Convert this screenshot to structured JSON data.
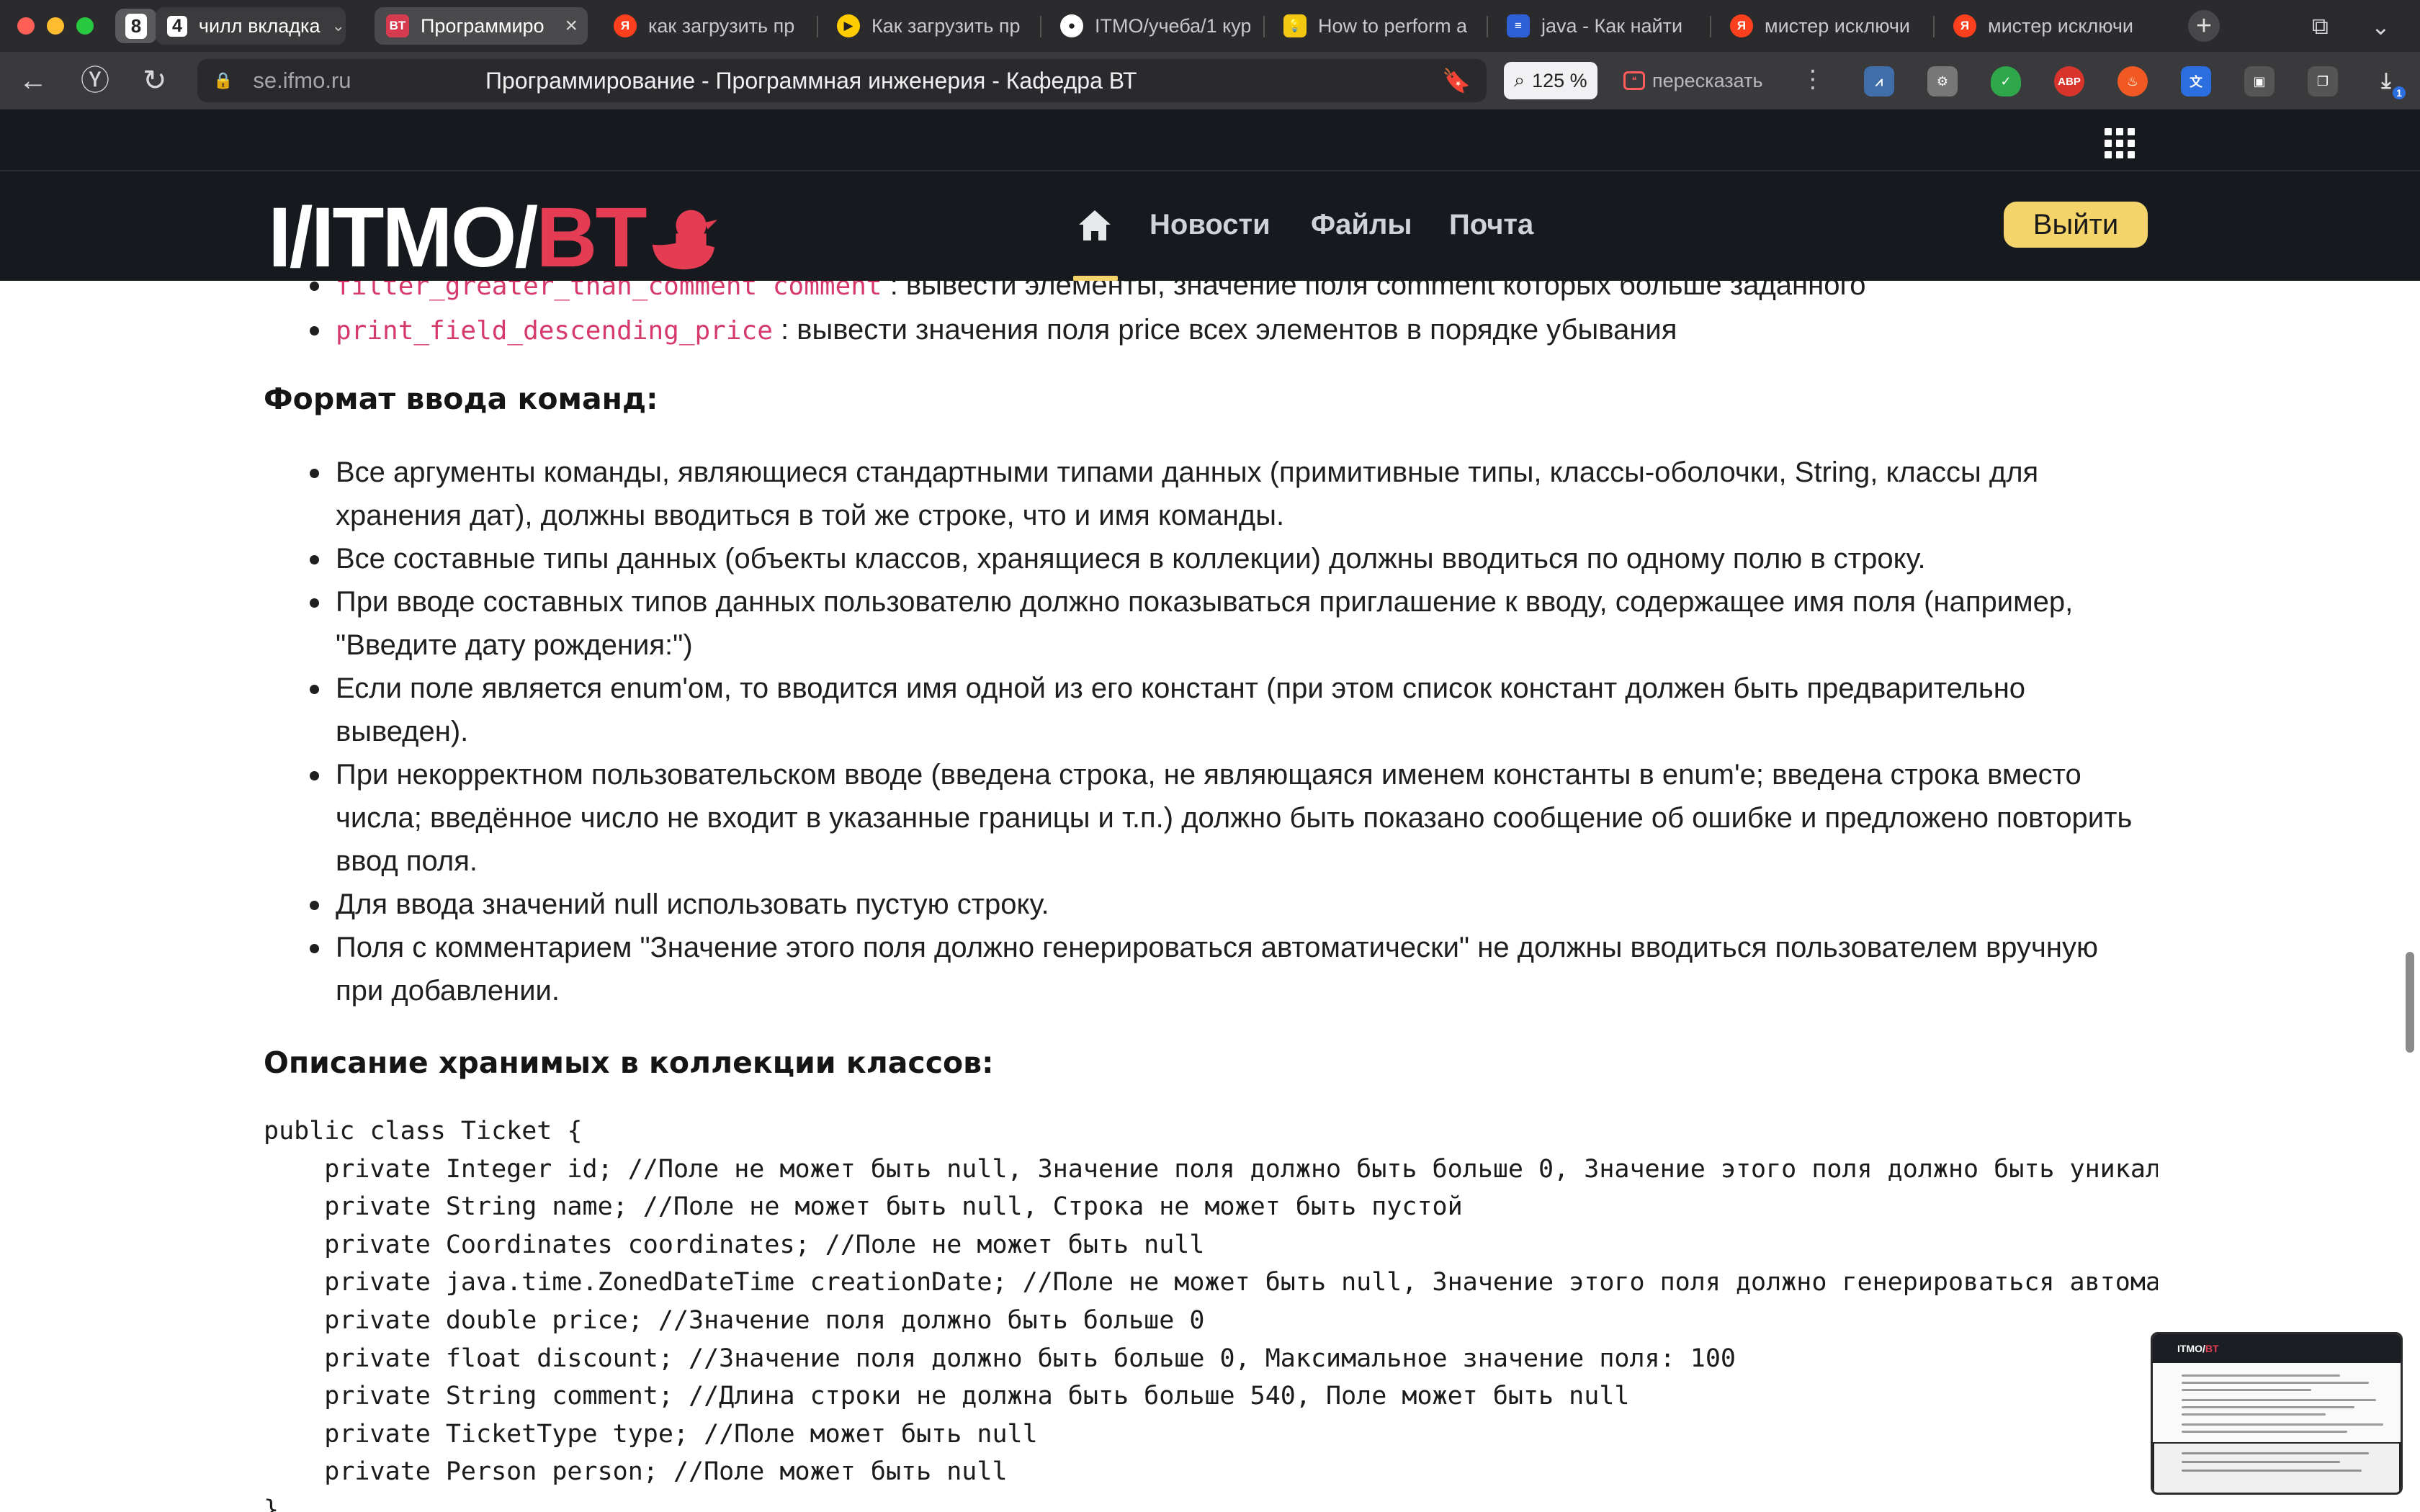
{
  "browser": {
    "tab_group_count": "8",
    "tabs": [
      {
        "label": "чилл вкладка",
        "badge": "4"
      },
      {
        "label": "Программиро",
        "favicon": "BT",
        "active": true
      },
      {
        "label": "как загрузить пр",
        "favicon": "Я"
      },
      {
        "label": "Как загрузить пр",
        "favicon": "▶"
      },
      {
        "label": "ITMO/учеба/1 кур",
        "favicon": "gh"
      },
      {
        "label": "How to perform a",
        "favicon": "bulb"
      },
      {
        "label": "java - Как найти",
        "favicon": "so"
      },
      {
        "label": "мистер исключи",
        "favicon": "Я"
      },
      {
        "label": "мистер исключи",
        "favicon": "Я"
      }
    ],
    "url_host": "se.ifmo.ru",
    "page_title": "Программирование - Программная инженерия - Кафедра ВТ",
    "zoom": "125 %",
    "retell_label": "пересказать",
    "extensions": [
      "chart-ext",
      "robot-ext",
      "shield-ext",
      "ABP",
      "fire-ext",
      "translate-ext",
      "screen-ext",
      "clipboard-ext",
      "download-ext"
    ],
    "abp_label": "ABP",
    "download_badge": "1"
  },
  "site": {
    "logo_main": "I/ITMO/",
    "logo_accent": "BT",
    "nav": [
      {
        "label": "Новости"
      },
      {
        "label": "Файлы"
      },
      {
        "label": "Почта"
      }
    ],
    "logout_label": "Выйти"
  },
  "content": {
    "commands": [
      {
        "code": "filter_greater_than_comment comment",
        "text": " : вывести элементы, значение поля comment которых больше заданного"
      },
      {
        "code": "print_field_descending_price",
        "text": " : вывести значения поля price всех элементов в порядке убывания"
      }
    ],
    "input_format_heading": "Формат ввода команд:",
    "input_rules": [
      "Все аргументы команды, являющиеся стандартными типами данных (примитивные типы, классы-оболочки, String, классы для хранения дат), должны вводиться в той же строке, что и имя команды.",
      "Все составные типы данных (объекты классов, хранящиеся в коллекции) должны вводиться по одному полю в строку.",
      "При вводе составных типов данных пользователю должно показываться приглашение к вводу, содержащее имя поля (например, \"Введите дату рождения:\")",
      "Если поле является enum'ом, то вводится имя одной из его констант (при этом список констант должен быть предварительно выведен).",
      "При некорректном пользовательском вводе (введена строка, не являющаяся именем константы в enum'е; введена строка вместо числа; введённое число не входит в указанные границы и т.п.) должно быть показано сообщение об ошибке и предложено повторить ввод поля.",
      "Для ввода значений null использовать пустую строку.",
      "Поля с комментарием \"Значение этого поля должно генерироваться автоматически\" не должны вводиться пользователем вручную при добавлении."
    ],
    "classes_heading": "Описание хранимых в коллекции классов:",
    "code_lines": [
      "public class Ticket {",
      "    private Integer id; //Поле не может быть null, Значение поля должно быть больше 0, Значение этого поля должно быть уникал",
      "    private String name; //Поле не может быть null, Строка не может быть пустой",
      "    private Coordinates coordinates; //Поле не может быть null",
      "    private java.time.ZonedDateTime creationDate; //Поле не может быть null, Значение этого поля должно генерироваться автома",
      "    private double price; //Значение поля должно быть больше 0",
      "    private float discount; //Значение поля должно быть больше 0, Максимальное значение поля: 100",
      "    private String comment; //Длина строки не должна быть больше 540, Поле может быть null",
      "    private TicketType type; //Поле может быть null",
      "    private Person person; //Поле может быть null",
      "}"
    ]
  },
  "colors": {
    "site_header_bg": "#16191d",
    "accent_yellow": "#f3d36a",
    "logo_red": "#e43d53",
    "inline_code": "#d63a6b"
  }
}
